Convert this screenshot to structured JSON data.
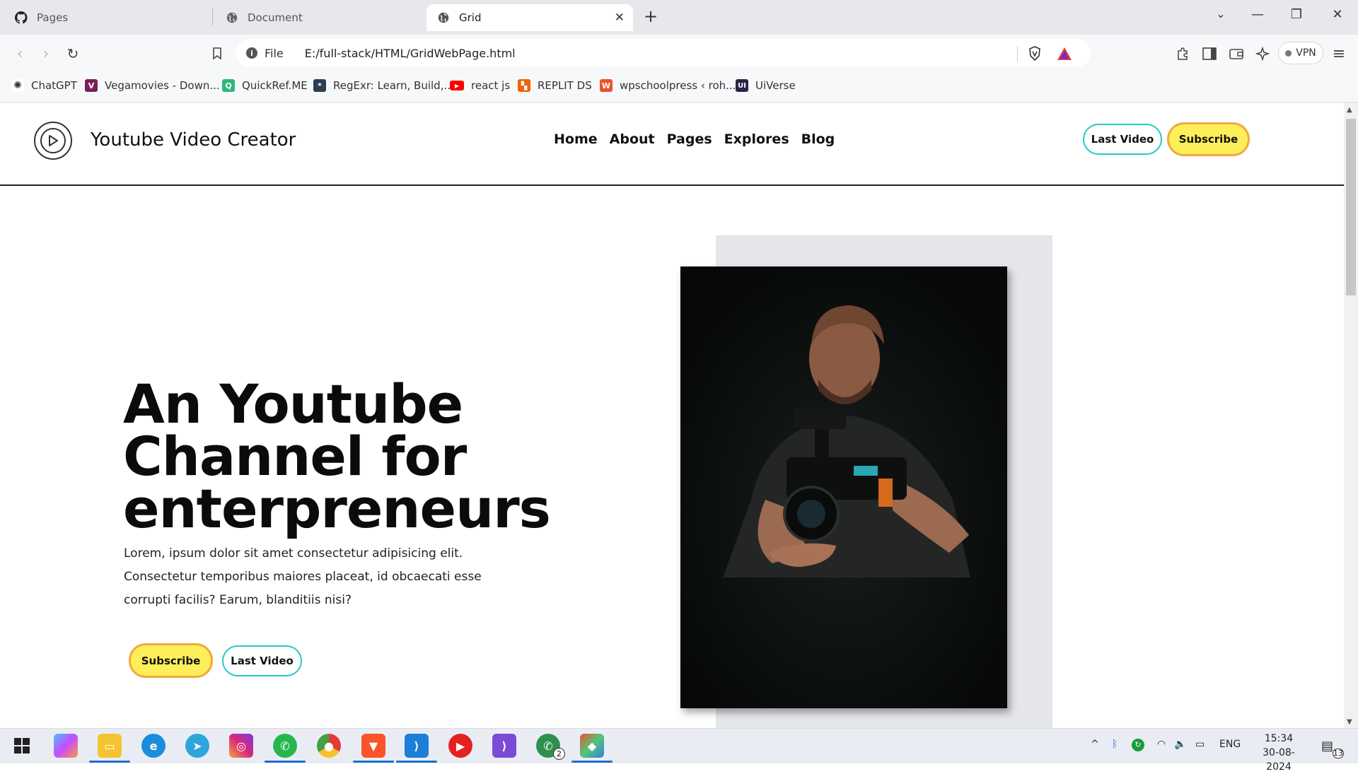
{
  "browser": {
    "tabs": [
      {
        "title": "Pages",
        "icon": "github-icon"
      },
      {
        "title": "Document",
        "icon": "globe-icon"
      },
      {
        "title": "Grid",
        "icon": "globe-icon"
      }
    ],
    "address": {
      "scheme_label": "File",
      "url": "E:/full-stack/HTML/GridWebPage.html"
    },
    "vpn_label": "VPN",
    "bookmarks": [
      {
        "label": "ChatGPT",
        "icon": "openai-icon",
        "color": "#333333"
      },
      {
        "label": "Vegamovies - Down...",
        "icon": "vegamovies-icon",
        "color": "#7a1f5c"
      },
      {
        "label": "QuickRef.ME",
        "icon": "quickref-icon",
        "color": "#2fb67c"
      },
      {
        "label": "RegExr: Learn, Build,...",
        "icon": "regexr-icon",
        "color": "#2b3e50"
      },
      {
        "label": "react js",
        "icon": "youtube-icon",
        "color": "#ff0000"
      },
      {
        "label": "REPLIT DS",
        "icon": "replit-icon",
        "color": "#f26207"
      },
      {
        "label": "wpschoolpress ‹ roh...",
        "icon": "wpschool-icon",
        "color": "#e8532b"
      },
      {
        "label": "UiVerse",
        "icon": "uiverse-icon",
        "color": "#2a2547"
      }
    ]
  },
  "site": {
    "brand": "Youtube Video Creator",
    "nav": [
      "Home",
      "About",
      "Pages",
      "Explores",
      "Blog"
    ],
    "header_buttons": {
      "last_video": "Last Video",
      "subscribe": "Subscribe"
    },
    "hero": {
      "title": "An Youtube Channel for enterpreneurs",
      "text": "Lorem, ipsum dolor sit amet consectetur adipisicing elit. Consectetur temporibus maiores placeat, id obcaecati esse corrupti facilis? Earum, blanditiis nisi?",
      "subscribe": "Subscribe",
      "last_video": "Last Video"
    },
    "colors": {
      "accent_yellow": "#fcef5a",
      "accent_orange": "#f2a93b",
      "accent_teal": "#27c8c8",
      "panel_gray": "#e5e6ea"
    }
  },
  "taskbar": {
    "apps": [
      "start-icon",
      "copilot-icon",
      "file-explorer-icon",
      "edge-icon",
      "telegram-icon",
      "instagram-icon",
      "whatsapp-icon",
      "chrome-icon",
      "brave-icon",
      "vscode-icon",
      "youtube-music-icon",
      "visual-studio-icon",
      "whatsapp-business-icon",
      "git-icon"
    ],
    "whatsapp_badge": "2",
    "language": "ENG",
    "time": "15:34",
    "date": "30-08-2024",
    "notifications": "13"
  }
}
